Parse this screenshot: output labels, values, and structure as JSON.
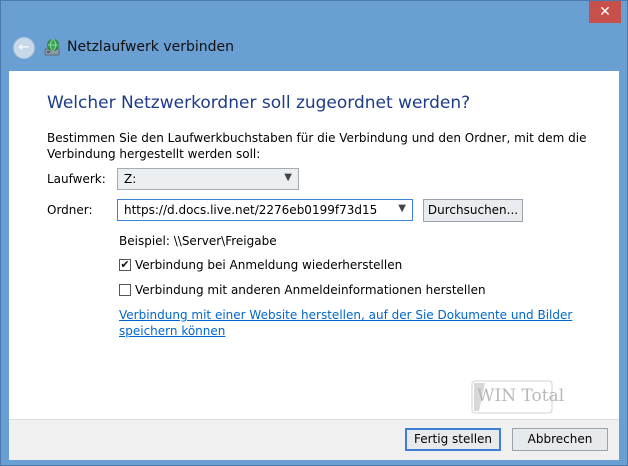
{
  "window": {
    "close_glyph": "✕"
  },
  "titlebar": {
    "title": "Netzlaufwerk verbinden",
    "back_icon": "back-arrow-icon",
    "app_icon": "network-drive-icon"
  },
  "main": {
    "heading": "Welcher Netzwerkordner soll zugeordnet werden?",
    "description": "Bestimmen Sie den Laufwerkbuchstaben für die Verbindung und den Ordner, mit dem die Verbindung hergestellt werden soll:",
    "drive": {
      "label": "Laufwerk:",
      "value": "Z:"
    },
    "folder": {
      "label": "Ordner:",
      "value": "https://d.docs.live.net/2276eb0199f73d15"
    },
    "browse_label": "Durchsuchen...",
    "example": "Beispiel: \\\\Server\\Freigabe",
    "reconnect": {
      "label": "Verbindung bei Anmeldung wiederherstellen",
      "checked": true
    },
    "other_credentials": {
      "label": "Verbindung mit anderen Anmeldeinformationen herstellen",
      "checked": false
    },
    "website_link": "Verbindung mit einer Website herstellen, auf der Sie Dokumente und Bilder speichern können"
  },
  "watermark": {
    "text": "WIN Total"
  },
  "footer": {
    "finish_label": "Fertig stellen",
    "cancel_label": "Abbrechen"
  },
  "colors": {
    "frame": "#6a9fd4",
    "heading": "#1e3a8a",
    "link": "#0066cc",
    "close": "#c7504a",
    "focus": "#3c7fd4"
  }
}
